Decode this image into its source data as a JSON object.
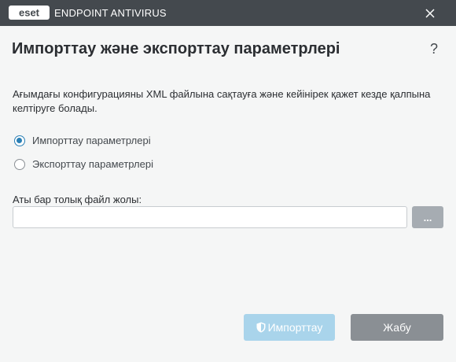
{
  "window": {
    "brand": "eset",
    "product": "ENDPOINT ANTIVIRUS",
    "close_icon": "close-icon"
  },
  "dialog": {
    "title": "Импорттау және экспорттау параметрлері",
    "help": "?",
    "description": "Ағымдағы конфигурацияны XML файлына сақтауға және кейінірек қажет кезде қалпына келтіруге болады.",
    "options": [
      {
        "label": "Импорттау параметрлері",
        "selected": true
      },
      {
        "label": "Экспорттау параметрлері",
        "selected": false
      }
    ],
    "path_label": "Аты бар толық файл жолы:",
    "path_value": "",
    "browse_label": "...",
    "import_label": "Импорттау",
    "close_label": "Жабу"
  },
  "colors": {
    "titlebar": "#44494e",
    "accent": "#2a7fb5",
    "primary_disabled": "#a9d4eb",
    "secondary": "#8a8f94"
  }
}
